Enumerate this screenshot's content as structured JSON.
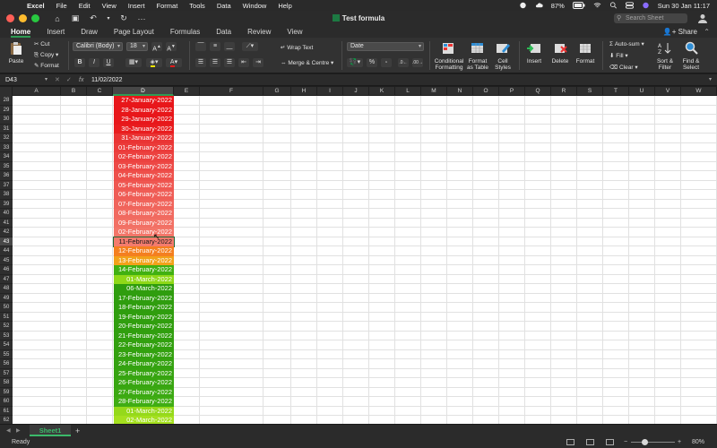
{
  "menubar": {
    "app": "Excel",
    "items": [
      "File",
      "Edit",
      "View",
      "Insert",
      "Format",
      "Tools",
      "Data",
      "Window",
      "Help"
    ],
    "battery": "87%",
    "datetime": "Sun 30 Jan  11:17"
  },
  "window": {
    "title": "Test formula",
    "search_placeholder": "Search Sheet"
  },
  "ribbon": {
    "tabs": [
      "Home",
      "Insert",
      "Draw",
      "Page Layout",
      "Formulas",
      "Data",
      "Review",
      "View"
    ],
    "active_tab": "Home",
    "share_label": "Share",
    "paste": "Paste",
    "cut": "Cut",
    "copy": "Copy",
    "format_painter": "Format",
    "font_name": "Calibri (Body)",
    "font_size": "18",
    "wrap_text": "Wrap Text",
    "merge_centre": "Merge & Centre",
    "number_format": "Date",
    "conditional_formatting": [
      "Conditional",
      "Formatting"
    ],
    "format_as_table": [
      "Format",
      "as Table"
    ],
    "cell_styles": [
      "Cell",
      "Styles"
    ],
    "insert": "Insert",
    "delete": "Delete",
    "format": "Format",
    "auto_sum": "Auto-sum",
    "fill": "Fill",
    "clear": "Clear",
    "sort_filter": [
      "Sort &",
      "Filter"
    ],
    "find_select": [
      "Find &",
      "Select"
    ]
  },
  "formula_bar": {
    "name_box": "D43",
    "fx": "fx",
    "value": "11/02/2022"
  },
  "grid": {
    "columns": [
      "A",
      "B",
      "C",
      "D",
      "E",
      "F",
      "G",
      "H",
      "I",
      "J",
      "K",
      "L",
      "M",
      "N",
      "O",
      "P",
      "Q",
      "R",
      "S",
      "T",
      "U",
      "V",
      "W"
    ],
    "selected_column": "D",
    "selected_row": 43,
    "rows": [
      {
        "n": 28,
        "v": "27-January-2022",
        "bg": "#e8161a"
      },
      {
        "n": 29,
        "v": "28-January-2022",
        "bg": "#e8161a"
      },
      {
        "n": 30,
        "v": "29-January-2022",
        "bg": "#e8171b"
      },
      {
        "n": 31,
        "v": "30-January-2022",
        "bg": "#e91d1f"
      },
      {
        "n": 32,
        "v": "31-January-2022",
        "bg": "#ea3434"
      },
      {
        "n": 33,
        "v": "01-February-2022",
        "bg": "#eb3b3a"
      },
      {
        "n": 34,
        "v": "02-February-2022",
        "bg": "#ec4240"
      },
      {
        "n": 35,
        "v": "03-February-2022",
        "bg": "#ed4946"
      },
      {
        "n": 36,
        "v": "04-February-2022",
        "bg": "#ee504b"
      },
      {
        "n": 37,
        "v": "05-February-2022",
        "bg": "#ef5751"
      },
      {
        "n": 38,
        "v": "06-February-2022",
        "bg": "#ef5d56"
      },
      {
        "n": 39,
        "v": "07-February-2022",
        "bg": "#f0645b"
      },
      {
        "n": 40,
        "v": "08-February-2022",
        "bg": "#f16a60"
      },
      {
        "n": 41,
        "v": "09-February-2022",
        "bg": "#f27064"
      },
      {
        "n": 42,
        "v": "02-February-2022",
        "bg": "#f37669"
      },
      {
        "n": 43,
        "v": "11-February-2022",
        "bg": "#f47b6d"
      },
      {
        "n": 44,
        "v": "12-February-2022",
        "bg": "#f47f1f"
      },
      {
        "n": 45,
        "v": "13-February-2022",
        "bg": "#f2a21a"
      },
      {
        "n": 46,
        "v": "14-February-2022",
        "bg": "#41b012"
      },
      {
        "n": 47,
        "v": "01-March-2022",
        "bg": "#8fd818"
      },
      {
        "n": 48,
        "v": "06-March-2022",
        "bg": "#2f9d0e"
      },
      {
        "n": 49,
        "v": "17-February-2022",
        "bg": "#2f9d0e"
      },
      {
        "n": 50,
        "v": "18-February-2022",
        "bg": "#2f9d0e"
      },
      {
        "n": 51,
        "v": "19-February-2022",
        "bg": "#309e0e"
      },
      {
        "n": 52,
        "v": "20-February-2022",
        "bg": "#309e0e"
      },
      {
        "n": 53,
        "v": "21-February-2022",
        "bg": "#319f0f"
      },
      {
        "n": 54,
        "v": "22-February-2022",
        "bg": "#32a00f"
      },
      {
        "n": 55,
        "v": "23-February-2022",
        "bg": "#33a10f"
      },
      {
        "n": 56,
        "v": "24-February-2022",
        "bg": "#34a210"
      },
      {
        "n": 57,
        "v": "25-February-2022",
        "bg": "#36a410"
      },
      {
        "n": 58,
        "v": "26-February-2022",
        "bg": "#38a611"
      },
      {
        "n": 59,
        "v": "27-February-2022",
        "bg": "#3ba912"
      },
      {
        "n": 60,
        "v": "28-February-2022",
        "bg": "#3fad13"
      },
      {
        "n": 61,
        "v": "01-March-2022",
        "bg": "#95d91a"
      },
      {
        "n": 62,
        "v": "02-March-2022",
        "bg": "#a5e01f"
      }
    ]
  },
  "sheets": {
    "tabs": [
      "Sheet1"
    ],
    "active": "Sheet1"
  },
  "status": {
    "ready": "Ready",
    "zoom": "80%"
  },
  "colors": {
    "accent": "#2e9b53",
    "chrome": "#2b2b2b"
  }
}
